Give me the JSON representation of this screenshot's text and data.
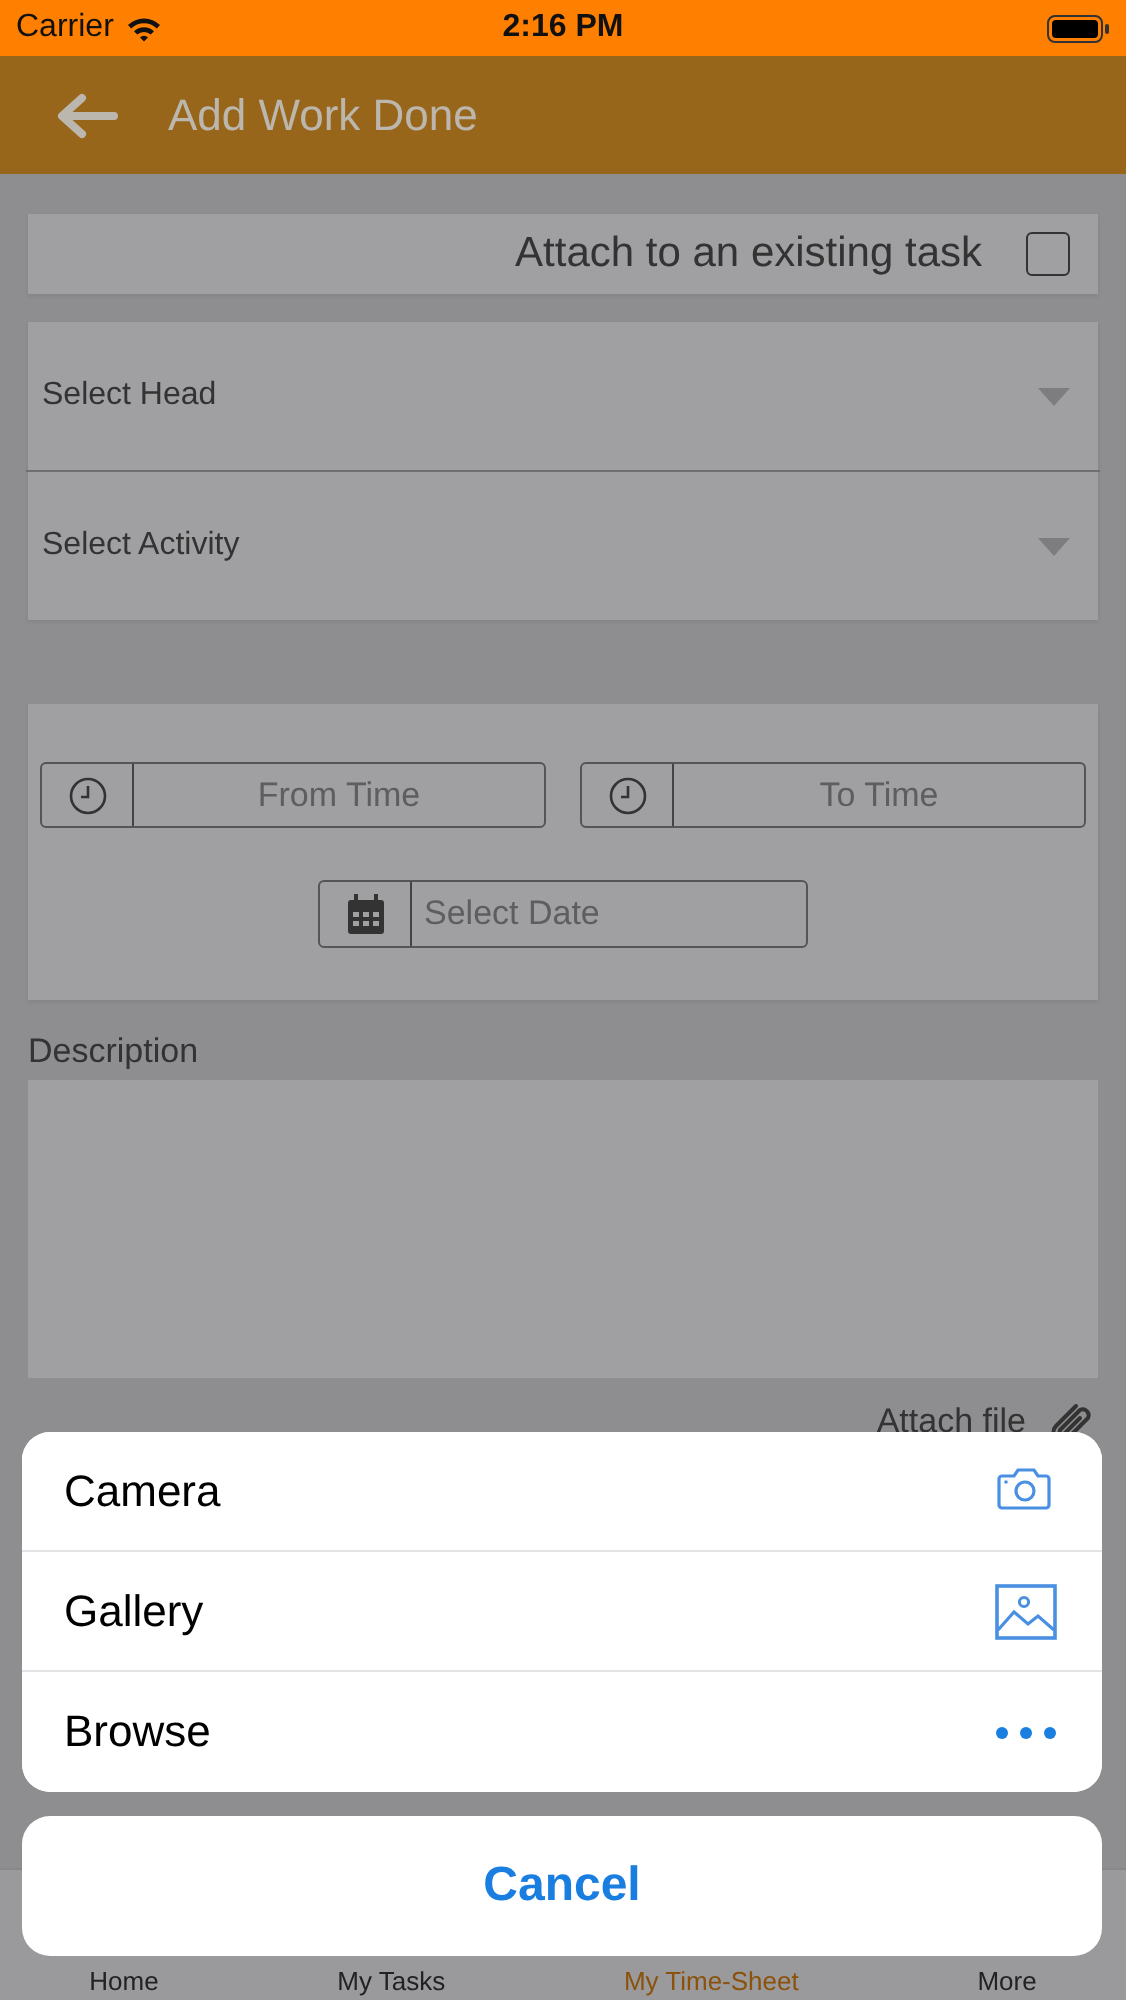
{
  "status_bar": {
    "carrier": "Carrier",
    "time": "2:16 PM"
  },
  "nav": {
    "title": "Add Work Done"
  },
  "attach_task": {
    "label": "Attach to an existing task",
    "checked": false
  },
  "dropdowns": [
    {
      "placeholder": "Select Head"
    },
    {
      "placeholder": "Select Activity"
    }
  ],
  "time_fields": [
    {
      "placeholder": "From Time"
    },
    {
      "placeholder": "To Time"
    }
  ],
  "date_field": {
    "placeholder": "Select Date"
  },
  "description": {
    "label": "Description"
  },
  "attach_file": {
    "label": "Attach file"
  },
  "tabs": [
    {
      "label": "Home",
      "selected": false
    },
    {
      "label": "My Tasks",
      "selected": false
    },
    {
      "label": "My Time-Sheet",
      "selected": true
    },
    {
      "label": "More",
      "selected": false
    }
  ],
  "action_sheet": {
    "options": [
      {
        "label": "Camera",
        "kind": "camera"
      },
      {
        "label": "Gallery",
        "kind": "gallery"
      },
      {
        "label": "Browse",
        "kind": "more"
      }
    ],
    "cancel": "Cancel"
  }
}
